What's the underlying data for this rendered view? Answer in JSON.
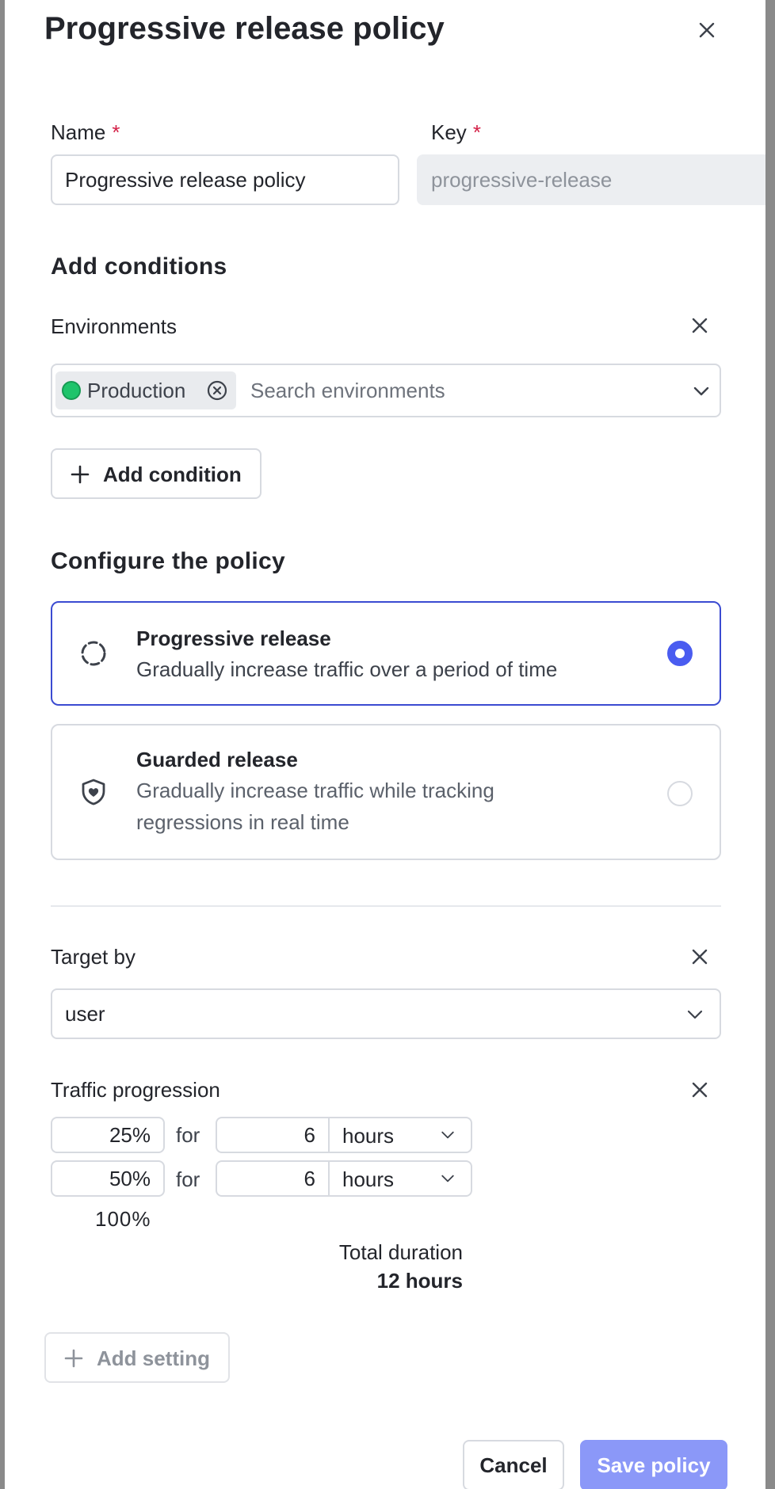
{
  "dialog": {
    "title": "Progressive release policy",
    "close_icon": "close-icon"
  },
  "form": {
    "name_label": "Name",
    "name_value": "Progressive release policy",
    "key_label": "Key",
    "key_placeholder": "progressive-release",
    "required_mark": "*"
  },
  "conditions": {
    "heading": "Add conditions",
    "environments_label": "Environments",
    "selected_env": "Production",
    "selected_env_color": "#1fc46b",
    "search_placeholder": "Search environments",
    "add_condition_label": "Add condition"
  },
  "policy": {
    "heading": "Configure the policy",
    "options": [
      {
        "title": "Progressive release",
        "description": "Gradually increase traffic over a period of time",
        "selected": true,
        "icon": "dashed-circle-icon"
      },
      {
        "title": "Guarded release",
        "description": "Gradually increase traffic while tracking regressions in real time",
        "selected": false,
        "icon": "shield-heart-icon"
      }
    ]
  },
  "target": {
    "label": "Target by",
    "value": "user"
  },
  "traffic": {
    "label": "Traffic progression",
    "for_text": "for",
    "steps": [
      {
        "percent": "25%",
        "duration": "6",
        "unit": "hours"
      },
      {
        "percent": "50%",
        "duration": "6",
        "unit": "hours"
      }
    ],
    "final_percent": "100%",
    "total_label": "Total duration",
    "total_value": "12 hours"
  },
  "actions": {
    "add_setting": "Add setting",
    "cancel": "Cancel",
    "save": "Save policy"
  },
  "colors": {
    "accent": "#4a5cf0",
    "selected_border": "#3b4bd1",
    "save_button": "#8b98f8",
    "required": "#d31f46"
  }
}
